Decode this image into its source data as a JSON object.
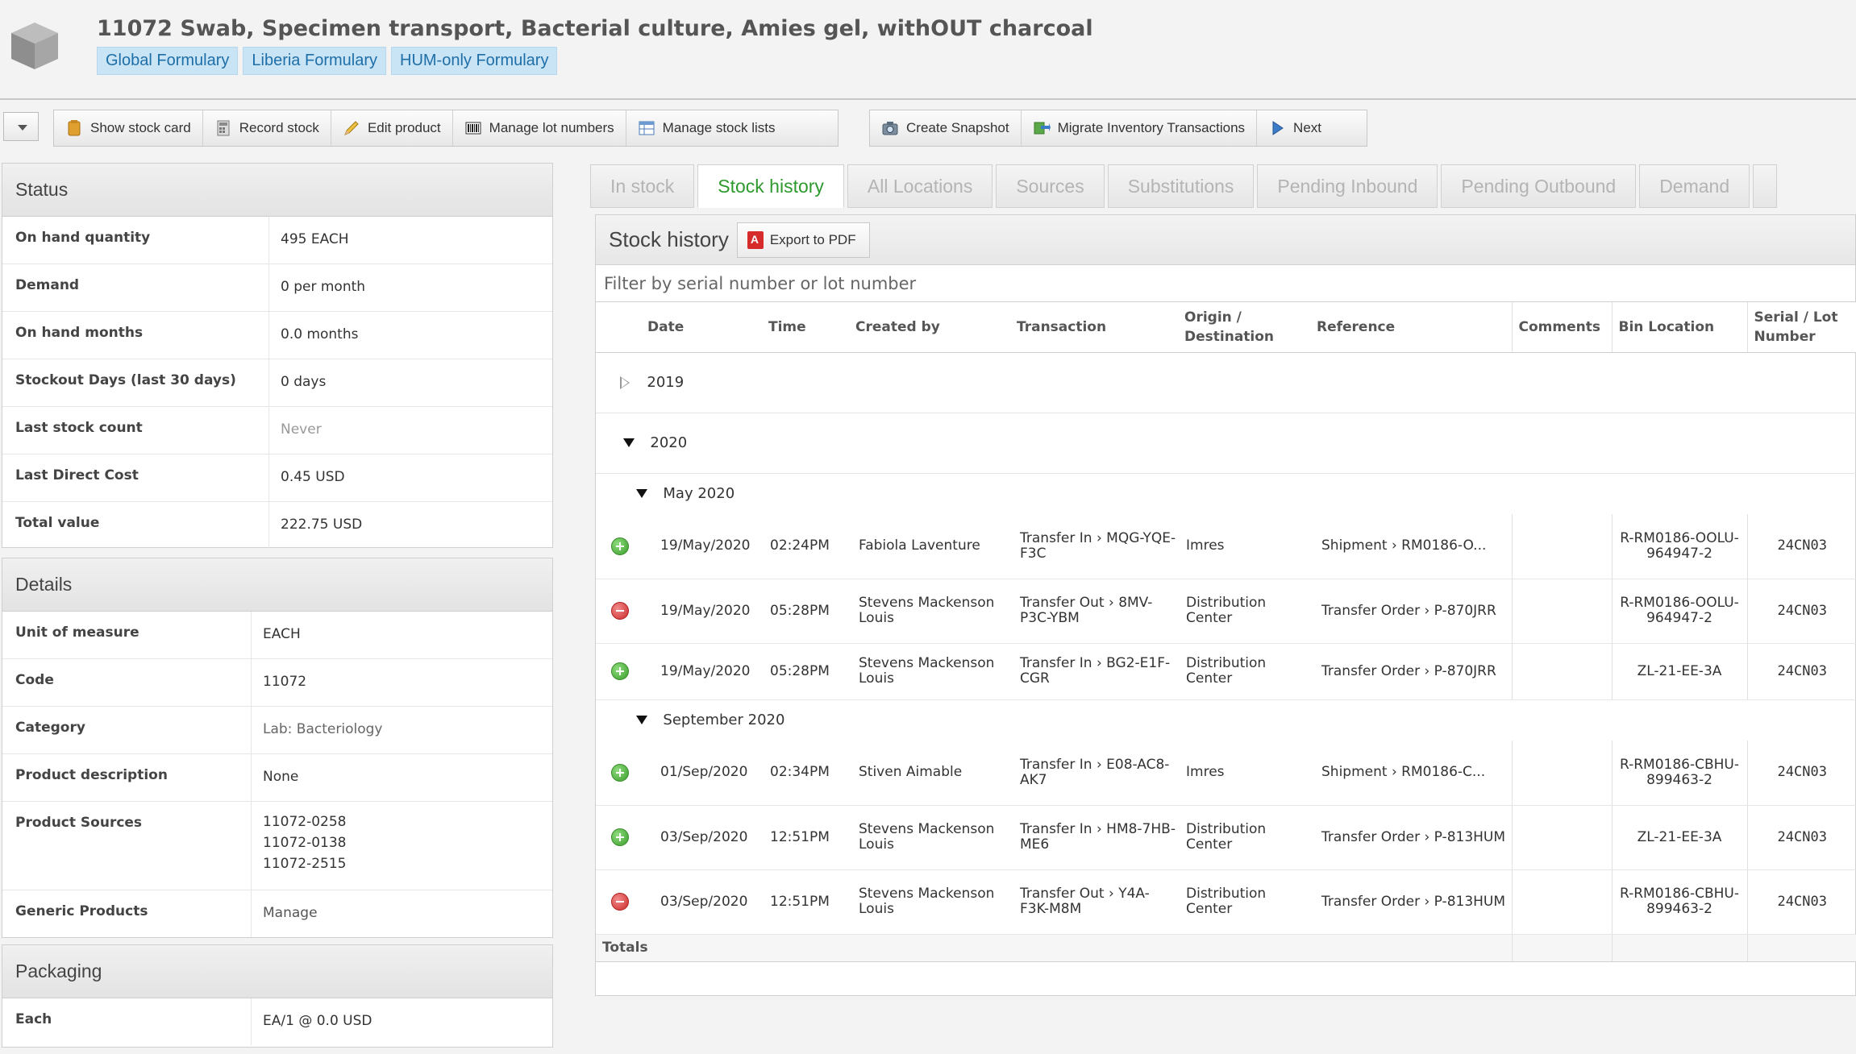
{
  "header": {
    "title": "11072 Swab, Specimen transport, Bacterial culture, Amies gel, withOUT charcoal",
    "formularies": [
      "Global Formulary",
      "Liberia Formulary",
      "HUM-only Formulary"
    ]
  },
  "toolbar": {
    "show_stock_card": "Show stock card",
    "record_stock": "Record stock",
    "edit_product": "Edit product",
    "manage_lot_numbers": "Manage lot numbers",
    "manage_stock_lists": "Manage stock lists",
    "create_snapshot": "Create Snapshot",
    "migrate_inventory": "Migrate Inventory Transactions",
    "next": "Next"
  },
  "status": {
    "title": "Status",
    "rows": [
      {
        "label": "On hand quantity",
        "value": "495 EACH"
      },
      {
        "label": "Demand",
        "value": "0 per month"
      },
      {
        "label": "On hand months",
        "value": "0.0 months"
      },
      {
        "label": "Stockout Days (last 30 days)",
        "value": "0 days"
      },
      {
        "label": "Last stock count",
        "value": "Never"
      },
      {
        "label": "Last Direct Cost",
        "value": "0.45 USD"
      },
      {
        "label": "Total value",
        "value": "222.75 USD"
      }
    ]
  },
  "details": {
    "title": "Details",
    "rows": [
      {
        "label": "Unit of measure",
        "value": "EACH"
      },
      {
        "label": "Code",
        "value": "11072"
      },
      {
        "label": "Category",
        "value": "Lab: Bacteriology"
      },
      {
        "label": "Product description",
        "value": "None"
      },
      {
        "label": "Product Sources",
        "values": [
          "11072-0258",
          "11072-0138",
          "11072-2515"
        ]
      },
      {
        "label": "Generic Products",
        "value": "Manage"
      }
    ]
  },
  "packaging": {
    "title": "Packaging",
    "rows": [
      {
        "label": "Each",
        "value": "EA/1 @ 0.0 USD"
      }
    ]
  },
  "tabs": [
    "In stock",
    "Stock history",
    "All Locations",
    "Sources",
    "Substitutions",
    "Pending Inbound",
    "Pending Outbound",
    "Demand"
  ],
  "history": {
    "title": "Stock history",
    "export_label": "Export to PDF",
    "filter_placeholder": "Filter by serial number or lot number",
    "columns": {
      "date": "Date",
      "time": "Time",
      "created_by": "Created by",
      "transaction": "Transaction",
      "origin1": "Origin /",
      "origin2": "Destination",
      "reference": "Reference",
      "comments": "Comments",
      "bin": "Bin Location",
      "serial1": "Serial / Lot",
      "serial2": "Number"
    },
    "year_2019": "2019",
    "year_2020": "2020",
    "month_may": "May 2020",
    "month_sep": "September 2020",
    "rows": [
      {
        "type": "in",
        "date": "19/May/2020",
        "time": "02:24PM",
        "created_by": "Fabiola Laventure",
        "transaction": "Transfer In › MQG-YQE-F3C",
        "origin": "Imres",
        "reference": "Shipment › RM0186-O...",
        "comments": "",
        "bin": "R-RM0186-OOLU-964947-2",
        "lot": "24CN03"
      },
      {
        "type": "out",
        "date": "19/May/2020",
        "time": "05:28PM",
        "created_by": "Stevens Mackenson Louis",
        "transaction": "Transfer Out › 8MV-P3C-YBM",
        "origin": "Distribution Center",
        "reference": "Transfer Order › P-870JRR",
        "comments": "",
        "bin": "R-RM0186-OOLU-964947-2",
        "lot": "24CN03"
      },
      {
        "type": "in",
        "date": "19/May/2020",
        "time": "05:28PM",
        "created_by": "Stevens Mackenson Louis",
        "transaction": "Transfer In › BG2-E1F-CGR",
        "origin": "Distribution Center",
        "reference": "Transfer Order › P-870JRR",
        "comments": "",
        "bin": "ZL-21-EE-3A",
        "lot": "24CN03"
      },
      {
        "type": "in",
        "date": "01/Sep/2020",
        "time": "02:34PM",
        "created_by": "Stiven Aimable",
        "transaction": "Transfer In › E08-AC8-AK7",
        "origin": "Imres",
        "reference": "Shipment › RM0186-C...",
        "comments": "",
        "bin": "R-RM0186-CBHU-899463-2",
        "lot": "24CN03"
      },
      {
        "type": "in",
        "date": "03/Sep/2020",
        "time": "12:51PM",
        "created_by": "Stevens Mackenson Louis",
        "transaction": "Transfer In › HM8-7HB-ME6",
        "origin": "Distribution Center",
        "reference": "Transfer Order › P-813HUM",
        "comments": "",
        "bin": "ZL-21-EE-3A",
        "lot": "24CN03"
      },
      {
        "type": "out",
        "date": "03/Sep/2020",
        "time": "12:51PM",
        "created_by": "Stevens Mackenson Louis",
        "transaction": "Transfer Out › Y4A-F3K-M8M",
        "origin": "Distribution Center",
        "reference": "Transfer Order › P-813HUM",
        "comments": "",
        "bin": "R-RM0186-CBHU-899463-2",
        "lot": "24CN03"
      }
    ],
    "totals_label": "Totals"
  }
}
